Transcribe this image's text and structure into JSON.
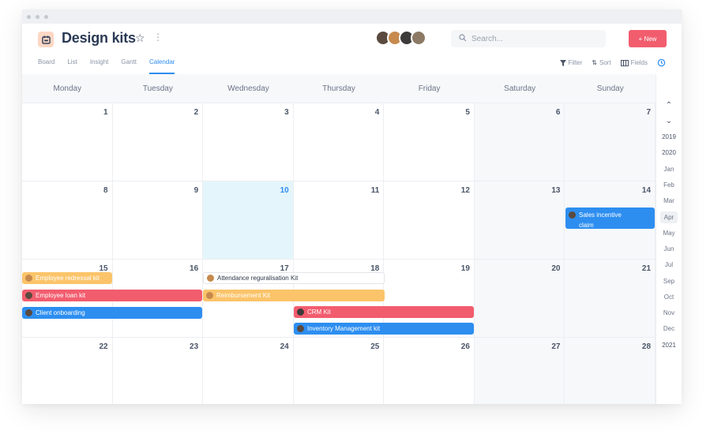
{
  "header": {
    "title": "Design kits",
    "icon": "calendar-icon",
    "search_placeholder": "Search...",
    "new_button": "+ New"
  },
  "tabs": [
    {
      "label": "Board",
      "active": false
    },
    {
      "label": "List",
      "active": false
    },
    {
      "label": "Insight",
      "active": false
    },
    {
      "label": "Gantt",
      "active": false
    },
    {
      "label": "Calendar",
      "active": true
    }
  ],
  "tools": {
    "filter": "Filter",
    "sort": "Sort",
    "fields": "Fields"
  },
  "days": [
    "Monday",
    "Tuesday",
    "Wednesday",
    "Thursday",
    "Friday",
    "Saturday",
    "Sunday"
  ],
  "weeks": [
    [
      "1",
      "2",
      "3",
      "4",
      "5",
      "6",
      "7"
    ],
    [
      "8",
      "9",
      "10",
      "11",
      "12",
      "13",
      "14"
    ],
    [
      "15",
      "16",
      "17",
      "18",
      "19",
      "20",
      "21"
    ],
    [
      "22",
      "23",
      "24",
      "25",
      "26",
      "27",
      "28"
    ]
  ],
  "events": {
    "sales_incentive": "Sales incentive claim",
    "employee_redressal": "Employee redressal kit",
    "attendance": "Attendance reguralisation Kit",
    "employee_loan": "Employee loan kit",
    "reimbursement": "Reimbursement Kit",
    "client_onboarding": "Client onboarding",
    "crm": "CRM Kit",
    "inventory": "Inventory Management kit"
  },
  "year_nav": [
    "2019",
    "2020",
    "Jan",
    "Feb",
    "Mar",
    "Apr",
    "May",
    "Jun",
    "Jul",
    "Sep",
    "Oct",
    "Nov",
    "Dec",
    "2021"
  ],
  "selected_month": "Apr",
  "colors": {
    "accent": "#2d8ef0",
    "new_button": "#f25d6e",
    "event_yellow": "#fbc46a",
    "event_red": "#f25d6e",
    "event_blue": "#2d8ef0",
    "today": "#e4f6fb"
  }
}
